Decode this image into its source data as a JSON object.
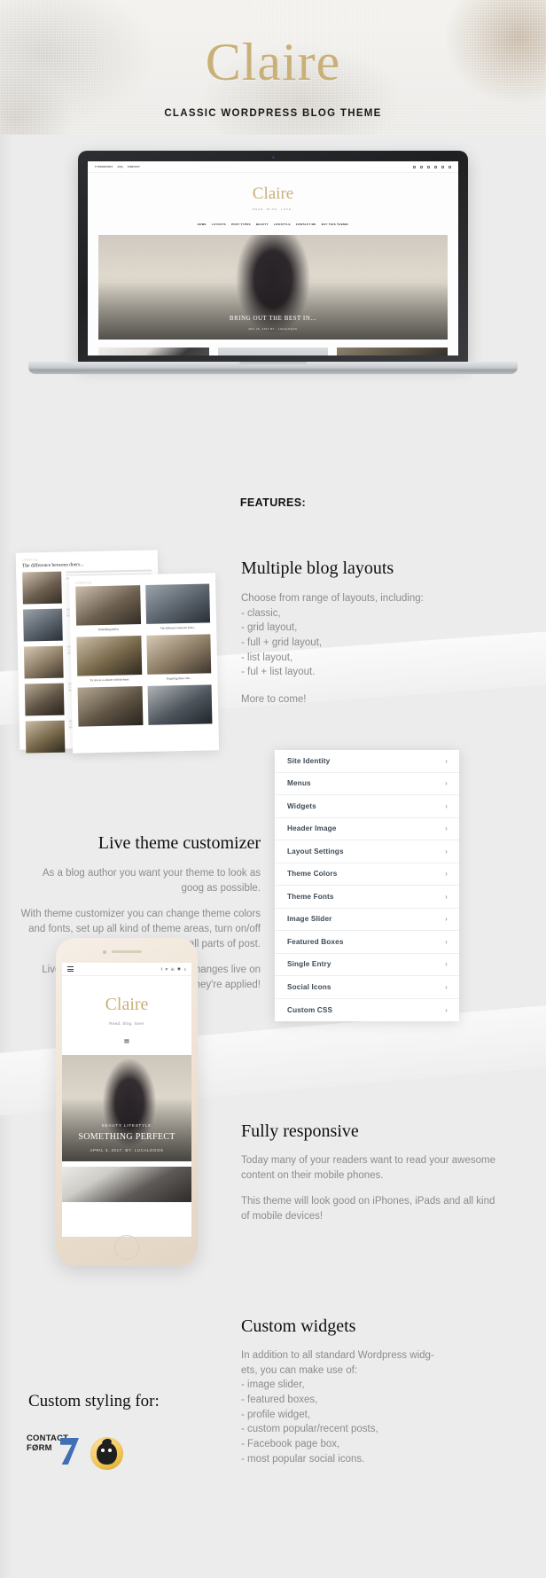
{
  "hero": {
    "brand": "Claire",
    "tagline": "CLASSIC WORDPRESS BLOG THEME"
  },
  "laptop_preview": {
    "topbar_links": [
      "TYPOGRAPHY",
      "FAQ",
      "CONTACT"
    ],
    "social_icons": [
      "instagram-icon",
      "facebook-icon",
      "twitter-icon",
      "pinterest-icon",
      "bloglovin-icon"
    ],
    "search_icon": "search-icon",
    "site_title": "Claire",
    "site_subtitle": "READ. BLOG. LOVE.",
    "nav_items": [
      "HOME",
      "LAYOUTS",
      "POST TYPES",
      "BEAUTY",
      "LIFESTYLE",
      "CONTACT ME",
      "BUY THIS THEME!"
    ],
    "featured_title": "BRING OUT THE BEST IN...",
    "featured_meta": "MAY 25, 2017     BY : LUCALOGOS"
  },
  "features_label": "FEATURES:",
  "layout_mocks": {
    "mock_a": {
      "kicker": "LIFESTYLE",
      "heading": "The difference between doers...",
      "rows": [
        "list-item",
        "list-item",
        "list-item",
        "list-item"
      ]
    },
    "mock_b": {
      "kicker": "LIFESTYLE",
      "captions": [
        "Something perfect",
        "The difference between doers...",
        "To love is to admire with the heart",
        "Forgiving those who..."
      ]
    }
  },
  "multiple_layouts": {
    "title": "Multiple blog layouts",
    "body": "Choose from range of layouts, including:\n- classic,\n- grid layout,\n- full + grid layout,\n- list layout,\n- ful + list layout.",
    "more": "More to come!"
  },
  "live_customizer": {
    "title": "Live theme customizer",
    "p1": "As  a blog author you want your theme to look as goog as possible.",
    "p2": "With theme customizer you can change theme colors and fonts, set up all kind of theme areas, turn on/off all parts of post.",
    "p3": "Live customizer will  preview any changes live on your blog before they're applied!"
  },
  "customizer_panel": {
    "chevron": "›",
    "rows": [
      "Site Identity",
      "Menus",
      "Widgets",
      "Header Image",
      "Layout Settings",
      "Theme Colors",
      "Theme Fonts",
      "Image Slider",
      "Featured Boxes",
      "Single Entry",
      "Social Icons",
      "Custom CSS"
    ]
  },
  "phone_preview": {
    "menu_icon": "hamburger-menu-icon",
    "socials": [
      "facebook-icon",
      "pinterest-icon",
      "linkedin-icon",
      "instagram-icon"
    ],
    "search_icon": "search-icon",
    "title": "Claire",
    "subtitle": "Read. blog. love!",
    "divider_icon": "grid-icon",
    "post_categories": "BEAUTY  LIFESTYLE",
    "post_title": "SOMETHING PERFECT",
    "post_meta": "APRIL 3, 2017.   BY: LUCALOGOS"
  },
  "fully_responsive": {
    "title": "Fully responsive",
    "p1": "Today many of your readers want to read your awesome content on their mobile phones.",
    "p2": "This theme will look good on iPhones, iPads and all kind of mobile devices!"
  },
  "custom_widgets": {
    "title": "Custom widgets",
    "body": "In addition to all standard Wordpress widg-\nets, you can make use of:\n- image slider,\n- featured boxes,\n- profile widget,\n- custom popular/recent posts,\n- Facebook page box,\n- most popular social icons."
  },
  "custom_styling": {
    "title": "Custom styling for:",
    "logos": [
      {
        "name": "contact-form-7-logo",
        "line1": "CONTACT",
        "line2": "FØRM"
      },
      {
        "name": "mailchimp-logo"
      }
    ]
  },
  "colors": {
    "gold": "#c9b079",
    "background": "#ececec",
    "body_text": "#8b8c8c",
    "heading": "#0f0f0f",
    "panel_text": "#3e4a54",
    "cf7_blue": "#3f6fb5",
    "mailchimp_yellow": "#f5c95c"
  }
}
